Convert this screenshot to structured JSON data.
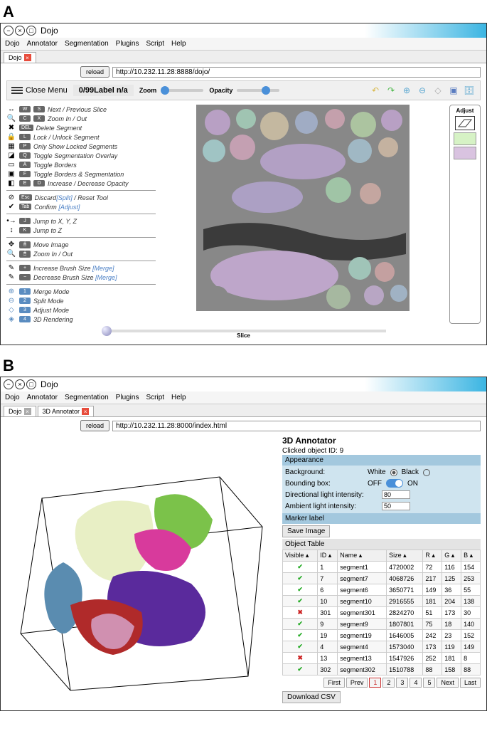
{
  "panelA": {
    "label": "A",
    "window_title": "Dojo",
    "menus": [
      "Dojo",
      "Annotator",
      "Segmentation",
      "Plugins",
      "Script",
      "Help"
    ],
    "tab_label": "Dojo",
    "reload_btn": "reload",
    "url": "http://10.232.11.28:8888/dojo/",
    "close_menu": "Close Menu",
    "counter": "0/99",
    "counter_label": "Label n/a",
    "zoom_label": "Zoom",
    "opacity_label": "Opacity",
    "adjust_label": "Adjust",
    "slice_label": "Slice",
    "shortcuts": [
      {
        "icon": "↔",
        "keys": [
          "W",
          "S"
        ],
        "label": "Next / Previous Slice"
      },
      {
        "icon": "🔍",
        "keys": [
          "C",
          "X"
        ],
        "label": "Zoom In / Out"
      },
      {
        "icon": "✖",
        "keys": [
          "DEL"
        ],
        "label": "Delete Segment"
      },
      {
        "icon": "🔒",
        "keys": [
          "L"
        ],
        "label": "Lock / Unlock Segment"
      },
      {
        "icon": "▦",
        "keys": [
          "P"
        ],
        "label": "Only Show Locked Segments"
      },
      {
        "icon": "◪",
        "keys": [
          "Q"
        ],
        "label": "Toggle Segmentation Overlay"
      },
      {
        "icon": "▭",
        "keys": [
          "A"
        ],
        "label": "Toggle Borders"
      },
      {
        "icon": "▣",
        "keys": [
          "F"
        ],
        "label": "Toggle Borders & Segmentation"
      },
      {
        "icon": "◧",
        "keys": [
          "E",
          "D"
        ],
        "label": "Increase / Decrease Opacity"
      }
    ],
    "confirm_rows": [
      {
        "icon": "⊘",
        "key": "Esc",
        "label": "Discard",
        "blue": "[Split]",
        "tail": " / Reset Tool"
      },
      {
        "icon": "✔",
        "key": "Tab",
        "label": "Confirm ",
        "blue": "[Adjust]",
        "tail": ""
      }
    ],
    "jump_rows": [
      {
        "icon": "•→",
        "key": "J",
        "label": "Jump to X, Y, Z"
      },
      {
        "icon": "↕",
        "key": "K",
        "label": "Jump to Z"
      }
    ],
    "mouse_rows": [
      {
        "icon": "✥",
        "label": "Move Image"
      },
      {
        "icon": "🔍",
        "label": "Zoom In / Out"
      }
    ],
    "brush_rows": [
      {
        "icon": "✎",
        "key": "+",
        "label": "Increase Brush Size ",
        "blue": "[Merge]"
      },
      {
        "icon": "✎",
        "key": "−",
        "label": "Decrease Brush Size ",
        "blue": "[Merge]"
      }
    ],
    "mode_rows": [
      {
        "icon": "⊕",
        "key": "1",
        "label": "Merge Mode"
      },
      {
        "icon": "⊖",
        "key": "2",
        "label": "Split Mode"
      },
      {
        "icon": "◇",
        "key": "3",
        "label": "Adjust Mode"
      },
      {
        "icon": "◈",
        "key": "4",
        "label": "3D Rendering"
      }
    ],
    "swatches": [
      "#d6f2c5",
      "#d9c3e0"
    ]
  },
  "panelB": {
    "label": "B",
    "window_title": "Dojo",
    "menus": [
      "Dojo",
      "Annotator",
      "Segmentation",
      "Plugins",
      "Script",
      "Help"
    ],
    "tabs": [
      "Dojo",
      "3D Annotator"
    ],
    "reload_btn": "reload",
    "url": "http://10.232.11.28:8000/index.html",
    "title3d": "3D Annotator",
    "clicked_id_label": "Clicked object ID: 9",
    "appearance_header": "Appearance",
    "bg_label": "Background:",
    "bg_white": "White",
    "bg_black": "Black",
    "bbox_label": "Bounding box:",
    "bbox_off": "OFF",
    "bbox_on": "ON",
    "dir_light_label": "Directional light intensity:",
    "dir_light_val": "80",
    "amb_light_label": "Ambient light intensity:",
    "amb_light_val": "50",
    "marker_label": "Marker label",
    "save_image": "Save Image",
    "object_table_header": "Object Table",
    "columns": [
      "Visible",
      "ID",
      "Name",
      "Size",
      "R",
      "G",
      "B"
    ],
    "rows": [
      {
        "vis": true,
        "id": "1",
        "name": "segment1",
        "size": "4720002",
        "r": "72",
        "g": "116",
        "b": "154"
      },
      {
        "vis": true,
        "id": "7",
        "name": "segment7",
        "size": "4068726",
        "r": "217",
        "g": "125",
        "b": "253"
      },
      {
        "vis": true,
        "id": "6",
        "name": "segment6",
        "size": "3650771",
        "r": "149",
        "g": "36",
        "b": "55"
      },
      {
        "vis": true,
        "id": "10",
        "name": "segment10",
        "size": "2916555",
        "r": "181",
        "g": "204",
        "b": "138"
      },
      {
        "vis": false,
        "id": "301",
        "name": "segment301",
        "size": "2824270",
        "r": "51",
        "g": "173",
        "b": "30"
      },
      {
        "vis": true,
        "id": "9",
        "name": "segment9",
        "size": "1807801",
        "r": "75",
        "g": "18",
        "b": "140"
      },
      {
        "vis": true,
        "id": "19",
        "name": "segment19",
        "size": "1646005",
        "r": "242",
        "g": "23",
        "b": "152"
      },
      {
        "vis": true,
        "id": "4",
        "name": "segment4",
        "size": "1573040",
        "r": "173",
        "g": "119",
        "b": "149"
      },
      {
        "vis": false,
        "id": "13",
        "name": "segment13",
        "size": "1547926",
        "r": "252",
        "g": "181",
        "b": "8"
      },
      {
        "vis": true,
        "id": "302",
        "name": "segment302",
        "size": "1510788",
        "r": "88",
        "g": "158",
        "b": "88"
      }
    ],
    "pagination": {
      "first": "First",
      "prev": "Prev",
      "pages": [
        "1",
        "2",
        "3",
        "4",
        "5"
      ],
      "current": "1",
      "next": "Next",
      "last": "Last"
    },
    "download_csv": "Download CSV"
  }
}
